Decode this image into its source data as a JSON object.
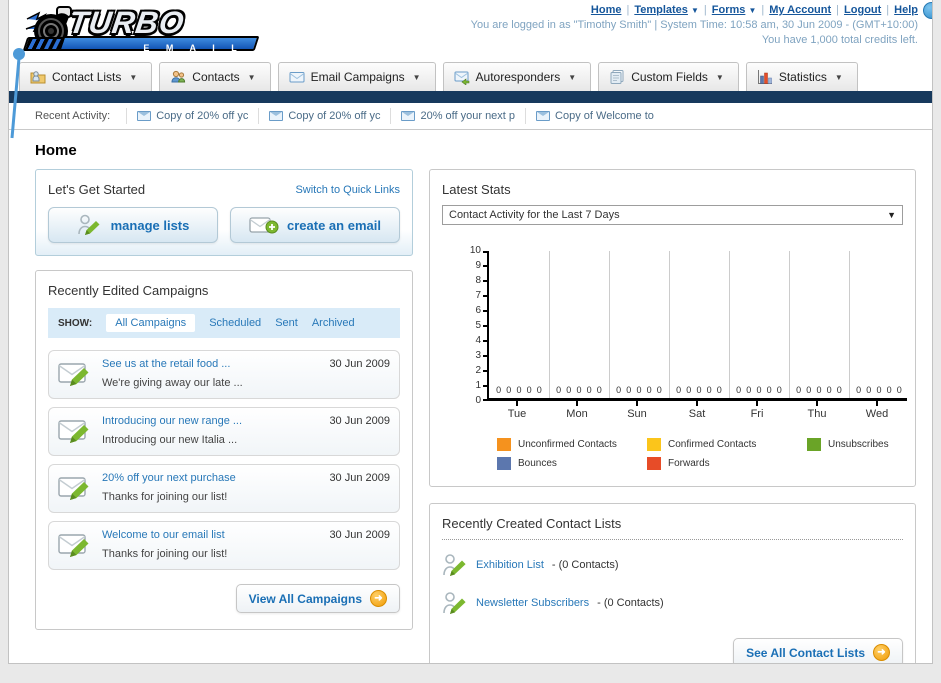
{
  "header": {
    "logo_primary": "TURBO",
    "logo_secondary": "E M A I L",
    "links": [
      "Home",
      "Templates",
      "Forms",
      "My Account",
      "Logout",
      "Help"
    ],
    "logged_in_text": "You are logged in as \"Timothy Smith\" | System Time: 10:58 am, 30 Jun 2009 - (GMT+10:00)",
    "credits_text": "You have 1,000 total credits left."
  },
  "tabs": [
    {
      "label": "Contact Lists"
    },
    {
      "label": "Contacts"
    },
    {
      "label": "Email Campaigns"
    },
    {
      "label": "Autoresponders"
    },
    {
      "label": "Custom Fields"
    },
    {
      "label": "Statistics"
    }
  ],
  "recent_activity": {
    "label": "Recent Activity:",
    "items": [
      "Copy of 20% off yc",
      "Copy of 20% off yc",
      "20% off your next p",
      "Copy of Welcome to"
    ]
  },
  "page_title": "Home",
  "get_started": {
    "title": "Let's Get Started",
    "switch_link": "Switch to Quick Links",
    "manage_lists_label": "manage lists",
    "create_email_label": "create an email"
  },
  "campaigns": {
    "title": "Recently Edited Campaigns",
    "show_label": "SHOW:",
    "filters": [
      "All Campaigns",
      "Scheduled",
      "Sent",
      "Archived"
    ],
    "selected_filter": "All Campaigns",
    "items": [
      {
        "title": "See us at the retail food ...",
        "subtitle": "We're giving away our late ...",
        "date": "30 Jun 2009"
      },
      {
        "title": "Introducing our new range ...",
        "subtitle": "Introducing our new Italia ...",
        "date": "30 Jun 2009"
      },
      {
        "title": "20% off your next purchase",
        "subtitle": "Thanks for joining our list!",
        "date": "30 Jun 2009"
      },
      {
        "title": "Welcome to our email list",
        "subtitle": "Thanks for joining our list!",
        "date": "30 Jun 2009"
      }
    ],
    "view_all_label": "View All Campaigns"
  },
  "stats": {
    "title": "Latest Stats",
    "dropdown_value": "Contact Activity for the Last 7 Days",
    "chart_data": {
      "type": "bar",
      "title": "Contact Activity for the Last 7 Days",
      "categories": [
        "Tue",
        "Mon",
        "Sun",
        "Sat",
        "Fri",
        "Thu",
        "Wed"
      ],
      "series": [
        {
          "name": "Unconfirmed Contacts",
          "color": "#F5921E",
          "values": [
            0,
            0,
            0,
            0,
            0,
            0,
            0
          ]
        },
        {
          "name": "Confirmed Contacts",
          "color": "#FBC51B",
          "values": [
            0,
            0,
            0,
            0,
            0,
            0,
            0
          ]
        },
        {
          "name": "Unsubscribes",
          "color": "#6AA427",
          "values": [
            0,
            0,
            0,
            0,
            0,
            0,
            0
          ]
        },
        {
          "name": "Bounces",
          "color": "#5C77AE",
          "values": [
            0,
            0,
            0,
            0,
            0,
            0,
            0
          ]
        },
        {
          "name": "Forwards",
          "color": "#E74C28",
          "values": [
            0,
            0,
            0,
            0,
            0,
            0,
            0
          ]
        }
      ],
      "ylim": [
        0,
        10
      ],
      "yticks": [
        0,
        1,
        2,
        3,
        4,
        5,
        6,
        7,
        8,
        9,
        10
      ],
      "grid": "vertical",
      "legend_position": "bottom",
      "value_labels_shown": true
    }
  },
  "contact_lists": {
    "title": "Recently Created Contact Lists",
    "items": [
      {
        "name": "Exhibition List",
        "detail": "- (0 Contacts)"
      },
      {
        "name": "Newsletter Subscribers",
        "detail": "- (0 Contacts)"
      }
    ],
    "see_all_label": "See All Contact Lists"
  },
  "colors": {
    "navy_bar": "#17395d",
    "link_blue": "#2878b8",
    "button_text_blue": "#1a6fb5",
    "muted_blue": "#7fa3c0",
    "filter_bar_bg": "#d9ebf8",
    "go_circle_orange": "#f09c07"
  }
}
